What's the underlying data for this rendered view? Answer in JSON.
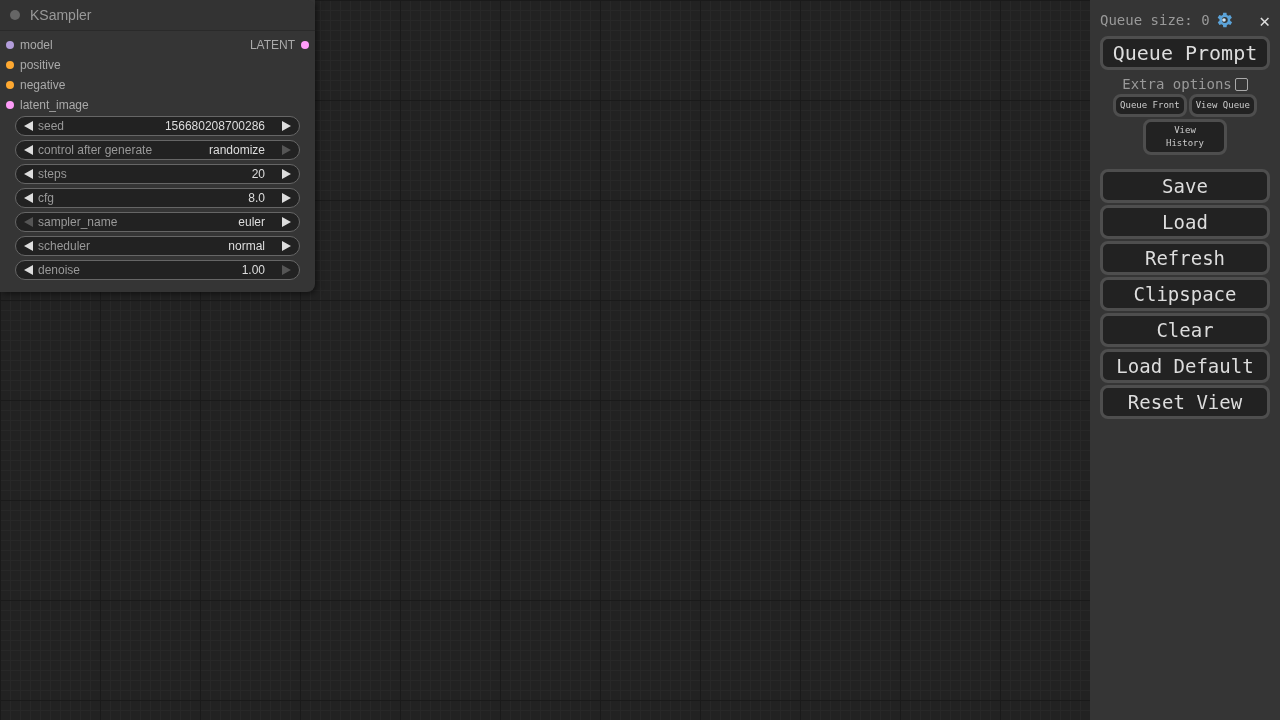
{
  "node": {
    "title": "KSampler",
    "inputs": [
      {
        "label": "model",
        "color": "#b39ddb"
      },
      {
        "label": "positive",
        "color": "#ffa931"
      },
      {
        "label": "negative",
        "color": "#ffa931"
      },
      {
        "label": "latent_image",
        "color": "#ff9cf9"
      }
    ],
    "outputs": [
      {
        "label": "LATENT",
        "color": "#ff9cf9"
      }
    ],
    "widgets": [
      {
        "label": "seed",
        "value": "156680208700286",
        "left_enabled": true,
        "right_enabled": true
      },
      {
        "label": "control after generate",
        "value": "randomize",
        "left_enabled": true,
        "right_enabled": false
      },
      {
        "label": "steps",
        "value": "20",
        "left_enabled": true,
        "right_enabled": true
      },
      {
        "label": "cfg",
        "value": "8.0",
        "left_enabled": true,
        "right_enabled": true
      },
      {
        "label": "sampler_name",
        "value": "euler",
        "left_enabled": false,
        "right_enabled": true
      },
      {
        "label": "scheduler",
        "value": "normal",
        "left_enabled": true,
        "right_enabled": true
      },
      {
        "label": "denoise",
        "value": "1.00",
        "left_enabled": true,
        "right_enabled": false
      }
    ]
  },
  "menu": {
    "queue_size": "Queue size: 0",
    "close": "✕",
    "queue_prompt": "Queue Prompt",
    "extra_options": {
      "label": "Extra options",
      "checked": false
    },
    "small_buttons": [
      "Queue Front",
      "View Queue"
    ],
    "history_button": "View History",
    "buttons": [
      "Save",
      "Load",
      "Refresh",
      "Clipspace",
      "Clear",
      "Load Default",
      "Reset View"
    ]
  }
}
